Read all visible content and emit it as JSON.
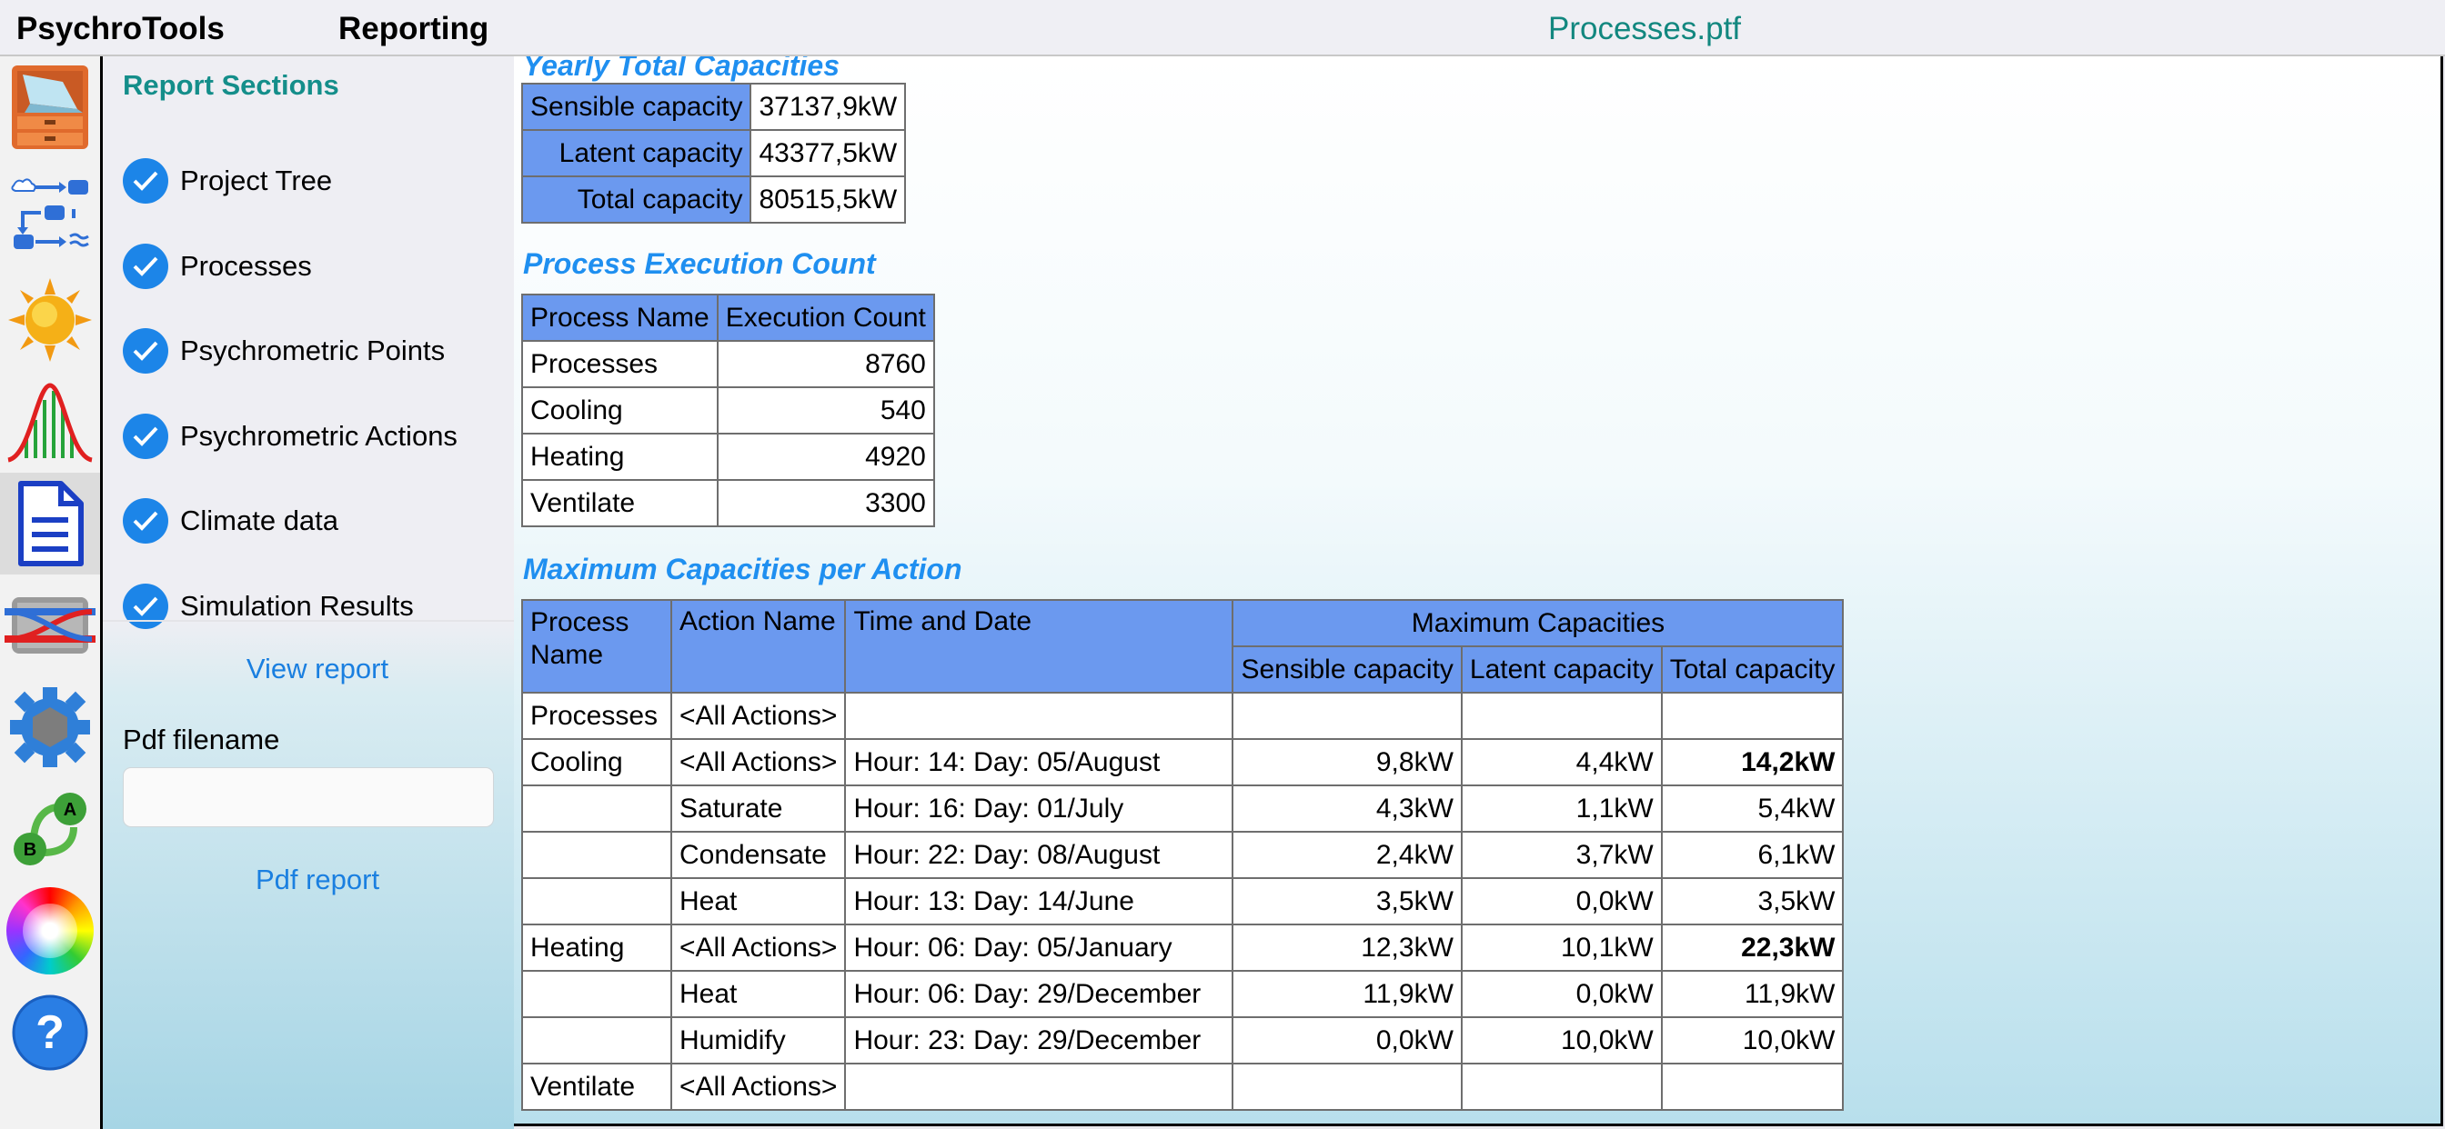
{
  "topbar": {
    "app_title": "PsychroTools",
    "section_title": "Reporting",
    "document_title": "Processes.ptf"
  },
  "sidebar": {
    "heading": "Report Sections",
    "sections": [
      {
        "label": "Project Tree",
        "checked": true
      },
      {
        "label": "Processes",
        "checked": true
      },
      {
        "label": "Psychrometric Points",
        "checked": true
      },
      {
        "label": "Psychrometric Actions",
        "checked": true
      },
      {
        "label": "Climate data",
        "checked": true
      },
      {
        "label": "Simulation Results",
        "checked": true
      }
    ],
    "view_report": "View report",
    "pdf_filename_label": "Pdf filename",
    "pdf_filename_value": "",
    "pdf_report": "Pdf report"
  },
  "toolbar": {
    "icons": [
      "cabinet-icon",
      "process-flow-icon",
      "sun-icon",
      "distribution-chart-icon",
      "document-icon",
      "heat-exchanger-icon",
      "gear-icon",
      "network-ab-icon",
      "color-wheel-icon",
      "help-icon"
    ],
    "active": "document-icon"
  },
  "report": {
    "yearly": {
      "title": "Yearly Total Capacities",
      "rows": [
        {
          "label": "Sensible capacity",
          "value": "37137,9kW"
        },
        {
          "label": "Latent capacity",
          "value": "43377,5kW"
        },
        {
          "label": "Total capacity",
          "value": "80515,5kW"
        }
      ]
    },
    "execution": {
      "title": "Process Execution Count",
      "headers": [
        "Process Name",
        "Execution Count"
      ],
      "rows": [
        {
          "name": "Processes",
          "count": "8760"
        },
        {
          "name": "Cooling",
          "count": "540"
        },
        {
          "name": "Heating",
          "count": "4920"
        },
        {
          "name": "Ventilate",
          "count": "3300"
        }
      ]
    },
    "max": {
      "title": "Maximum Capacities per Action",
      "headers": {
        "process_name": "Process Name",
        "action_name": "Action Name",
        "time_date": "Time and Date",
        "max_caps": "Maximum Capacities",
        "sensible": "Sensible capacity",
        "latent": "Latent capacity",
        "total": "Total capacity"
      },
      "rows": [
        {
          "process": "Processes",
          "action": "<All Actions>",
          "time": "",
          "sensible": "",
          "latent": "",
          "total": "",
          "bold": false
        },
        {
          "process": "Cooling",
          "action": "<All Actions>",
          "time": "Hour: 14:  Day: 05/August",
          "sensible": "9,8kW",
          "latent": "4,4kW",
          "total": "14,2kW",
          "bold": true
        },
        {
          "process": "",
          "action": "Saturate",
          "time": "Hour: 16:  Day: 01/July",
          "sensible": "4,3kW",
          "latent": "1,1kW",
          "total": "5,4kW",
          "bold": false
        },
        {
          "process": "",
          "action": "Condensate",
          "time": "Hour: 22:  Day: 08/August",
          "sensible": "2,4kW",
          "latent": "3,7kW",
          "total": "6,1kW",
          "bold": false
        },
        {
          "process": "",
          "action": "Heat",
          "time": "Hour: 13:  Day: 14/June",
          "sensible": "3,5kW",
          "latent": "0,0kW",
          "total": "3,5kW",
          "bold": false
        },
        {
          "process": "Heating",
          "action": "<All Actions>",
          "time": "Hour: 06:  Day: 05/January",
          "sensible": "12,3kW",
          "latent": "10,1kW",
          "total": "22,3kW",
          "bold": true
        },
        {
          "process": "",
          "action": "Heat",
          "time": "Hour: 06:  Day: 29/December",
          "sensible": "11,9kW",
          "latent": "0,0kW",
          "total": "11,9kW",
          "bold": false
        },
        {
          "process": "",
          "action": "Humidify",
          "time": "Hour: 23:  Day: 29/December",
          "sensible": "0,0kW",
          "latent": "10,0kW",
          "total": "10,0kW",
          "bold": false
        },
        {
          "process": "Ventilate",
          "action": "<All Actions>",
          "time": "",
          "sensible": "",
          "latent": "",
          "total": "",
          "bold": false
        }
      ]
    }
  }
}
